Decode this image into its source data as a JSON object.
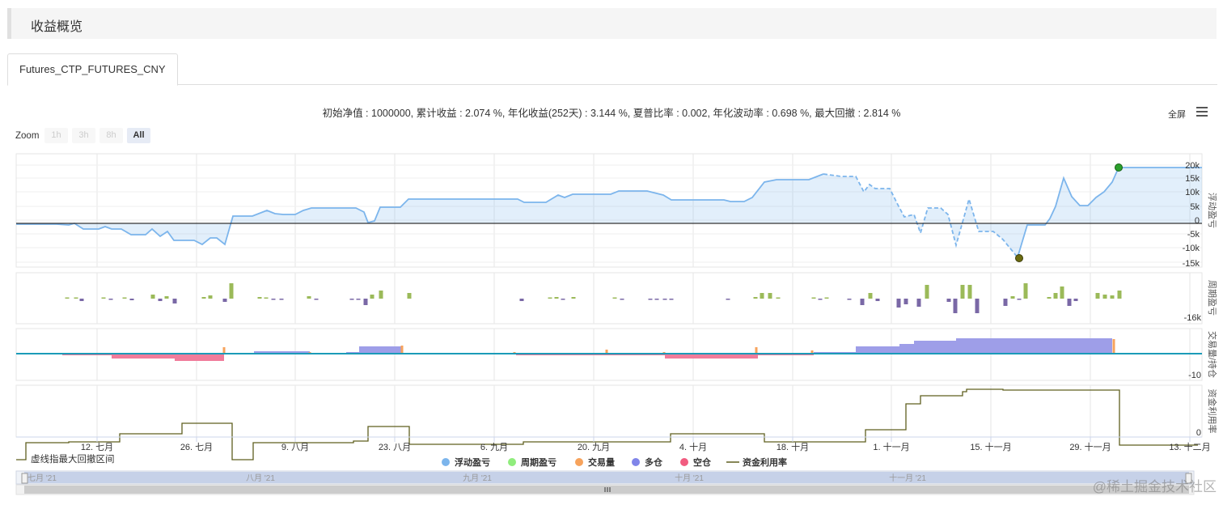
{
  "section": {
    "title": "收益概览"
  },
  "tabs": [
    {
      "label": "Futures_CTP_FUTURES_CNY"
    }
  ],
  "summary": {
    "text": "初始净值 : 1000000, 累计收益 : 2.074 %, 年化收益(252天) : 3.144 %, 夏普比率 : 0.002, 年化波动率 : 0.698 %, 最大回撤 : 2.814 %"
  },
  "toolbar": {
    "fullscreen_label": "全屏",
    "menu_icon": "hamburger-menu-icon"
  },
  "zoom": {
    "label": "Zoom",
    "buttons": [
      "1h",
      "3h",
      "8h",
      "All"
    ],
    "selected": "All"
  },
  "note": "虚线指最大回撤区间",
  "legend": [
    {
      "name": "浮动盈亏",
      "color": "#7cb5ec"
    },
    {
      "name": "周期盈亏",
      "color": "#90ed7d"
    },
    {
      "name": "交易量",
      "color": "#f7a35c"
    },
    {
      "name": "多仓",
      "color": "#8085e9"
    },
    {
      "name": "空仓",
      "color": "#f15c80"
    },
    {
      "name": "资金利用率",
      "color": "#5f5f1f"
    }
  ],
  "navigator": {
    "labels": [
      "七月 '21",
      "八月 '21",
      "九月 '21",
      "十月 '21",
      "十一月 '21"
    ]
  },
  "watermark": "@稀土掘金技术社区",
  "chart_data": {
    "type": "line",
    "x_axis": {
      "labels": [
        "12. 七月",
        "26. 七月",
        "9. 八月",
        "23. 八月",
        "6. 九月",
        "20. 九月",
        "4. 十月",
        "18. 十月",
        "1. 十一月",
        "15. 十一月",
        "29. 十一月",
        "13. 十二月"
      ]
    },
    "panes": [
      {
        "axis_title": "浮动盈亏",
        "ticks": [
          "20k",
          "15k",
          "10k",
          "5k",
          "0",
          "-5k",
          "-10k",
          "-15k"
        ],
        "series": {
          "name": "浮动盈亏",
          "drawdown_markers": [
            "peak",
            "trough"
          ]
        }
      },
      {
        "axis_title": "周期盈亏",
        "ticks": [
          "-16k"
        ]
      },
      {
        "axis_title": "交易量/持仓",
        "ticks": [
          "-10"
        ]
      },
      {
        "axis_title": "资金利用率",
        "ticks": [
          "0"
        ]
      }
    ]
  }
}
